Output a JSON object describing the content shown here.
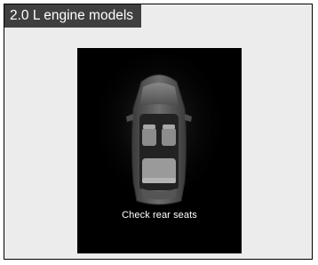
{
  "header": {
    "label": "2.0 L engine models"
  },
  "display": {
    "message": "Check rear seats",
    "background_color": "#000000",
    "icon": "car-top-view-icon"
  },
  "colors": {
    "header_background": "#3f3f3f",
    "panel_background": "#ececec"
  }
}
